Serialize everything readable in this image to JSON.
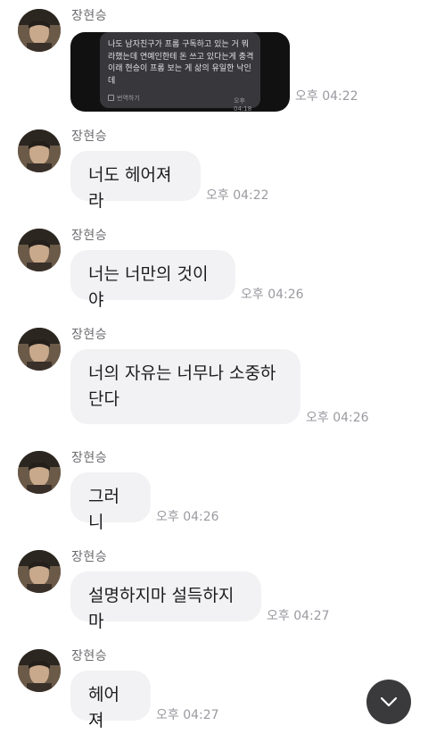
{
  "sender_name": "장현승",
  "image_message": {
    "text": "나도 남자친구가 프롬 구독하고 있는 거 뭐라했는데 연예인한테 돈 쓰고 있다는게 충격이래 현승이 프롬 보는 게 삶의 유일한 낙인데",
    "translate_label": "번역하기",
    "inner_time": "오후 04:18",
    "time": "오후 04:22"
  },
  "messages": [
    {
      "name": "장현승",
      "text": "너도 헤어져라",
      "time": "오후 04:22"
    },
    {
      "name": "장현승",
      "text": "너는 너만의 것이야",
      "time": "오후 04:26"
    },
    {
      "name": "장현승",
      "text": "너의 자유는 너무나 소중하단다",
      "time": "오후 04:26"
    },
    {
      "name": "장현승",
      "text": "그러니",
      "time": "오후 04:26"
    },
    {
      "name": "장현승",
      "text": "설명하지마 설득하지마",
      "time": "오후 04:27"
    },
    {
      "name": "장현승",
      "text": "헤어져",
      "time": "오후 04:27"
    }
  ],
  "scroll_button_icon": "chevron-down-icon"
}
